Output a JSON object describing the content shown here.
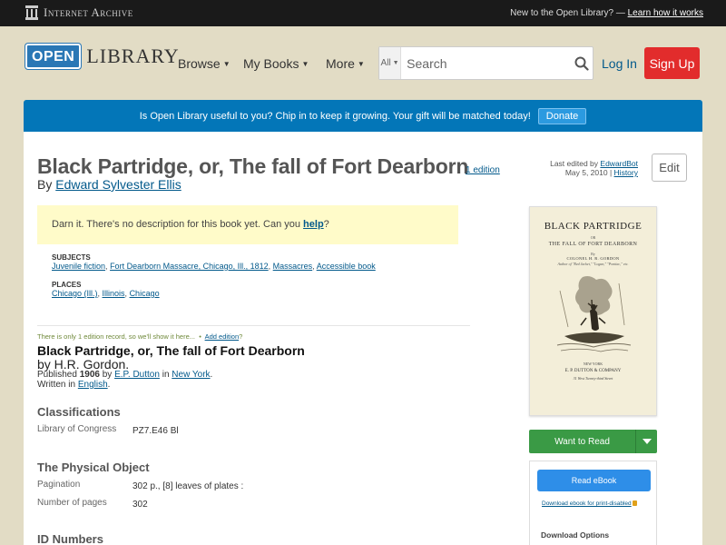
{
  "ia_bar": {
    "logo_text": "Internet Archive",
    "new_to": "New to the Open Library? —",
    "learn_link": "Learn how it works"
  },
  "header": {
    "logo_badge": "OPEN",
    "logo_text": "LIBRARY",
    "nav": {
      "browse": "Browse",
      "mybooks": "My Books",
      "more": "More"
    },
    "search": {
      "scope": "All",
      "placeholder": "Search"
    },
    "login": "Log In",
    "signup": "Sign Up"
  },
  "banner": {
    "text": "Is Open Library useful to you? Chip in to keep it growing. Your gift will be matched today!",
    "button": "Donate"
  },
  "work": {
    "title": "Black Partridge, or, The fall of Fort Dearborn",
    "edition_count": "1 edition",
    "by_prefix": "By",
    "author": "Edward Sylvester Ellis",
    "last_edited_prefix": "Last edited by",
    "last_edited_by": "EdwardBot",
    "last_edited_date": "May 5, 2010 |",
    "history": "History",
    "edit": "Edit",
    "no_description": "Darn it. There's no description for this book yet. Can you",
    "help": "help",
    "help_suffix": "?",
    "subjects_label": "SUBJECTS",
    "subjects": [
      "Juvenile fiction",
      "Fort Dearborn Massacre, Chicago, Ill., 1812",
      "Massacres",
      "Accessible book"
    ],
    "places_label": "PLACES",
    "places": [
      "Chicago (Ill.)",
      "Illinois",
      "Chicago"
    ]
  },
  "edition": {
    "only_one": "There is only 1 edition record, so we'll show it here...",
    "bullet": "•",
    "add_edition": "Add edition",
    "add_suffix": "?",
    "title": "Black Partridge, or, The fall of Fort Dearborn",
    "by": "by H.R. Gordon.",
    "published_prefix": "Published",
    "year": "1906",
    "by_word": "by",
    "publisher": "E.P. Dutton",
    "in_word": "in",
    "place": "New York",
    "place_suffix": ".",
    "written_in": "Written in",
    "language": "English",
    "language_suffix": "."
  },
  "classifications": {
    "heading": "Classifications",
    "loc_label": "Library of Congress",
    "loc_value": "PZ7.E46 Bl"
  },
  "physical": {
    "heading": "The Physical Object",
    "pagination_label": "Pagination",
    "pagination_value": "302 p., [8] leaves of plates :",
    "pages_label": "Number of pages",
    "pages_value": "302"
  },
  "id_numbers": {
    "heading": "ID Numbers"
  },
  "cover": {
    "title": "BLACK PARTRIDGE",
    "or": "OR",
    "subtitle": "THE FALL OF FORT DEARBORN",
    "by": "By",
    "author": "COLONEL H. R. GORDON",
    "works": "Author of \"Red Jacket,\" \"Logan,\" \"Pontiac,\" etc.",
    "city": "NEW YORK",
    "publisher": "E. P. DUTTON & COMPANY",
    "address": "31 West Twenty-third Street"
  },
  "sidebar": {
    "want_to_read": "Want to Read",
    "read_ebook": "Read eBook",
    "download_print": "Download ebook for print-disabled",
    "download_options": "Download Options"
  },
  "colors": {
    "link": "#02598b",
    "banner": "#0376b8",
    "signup": "#e22c2c",
    "want_green": "#3a9a45",
    "read_blue": "#2e8ee8",
    "nodesc_bg": "#fffbc9"
  }
}
